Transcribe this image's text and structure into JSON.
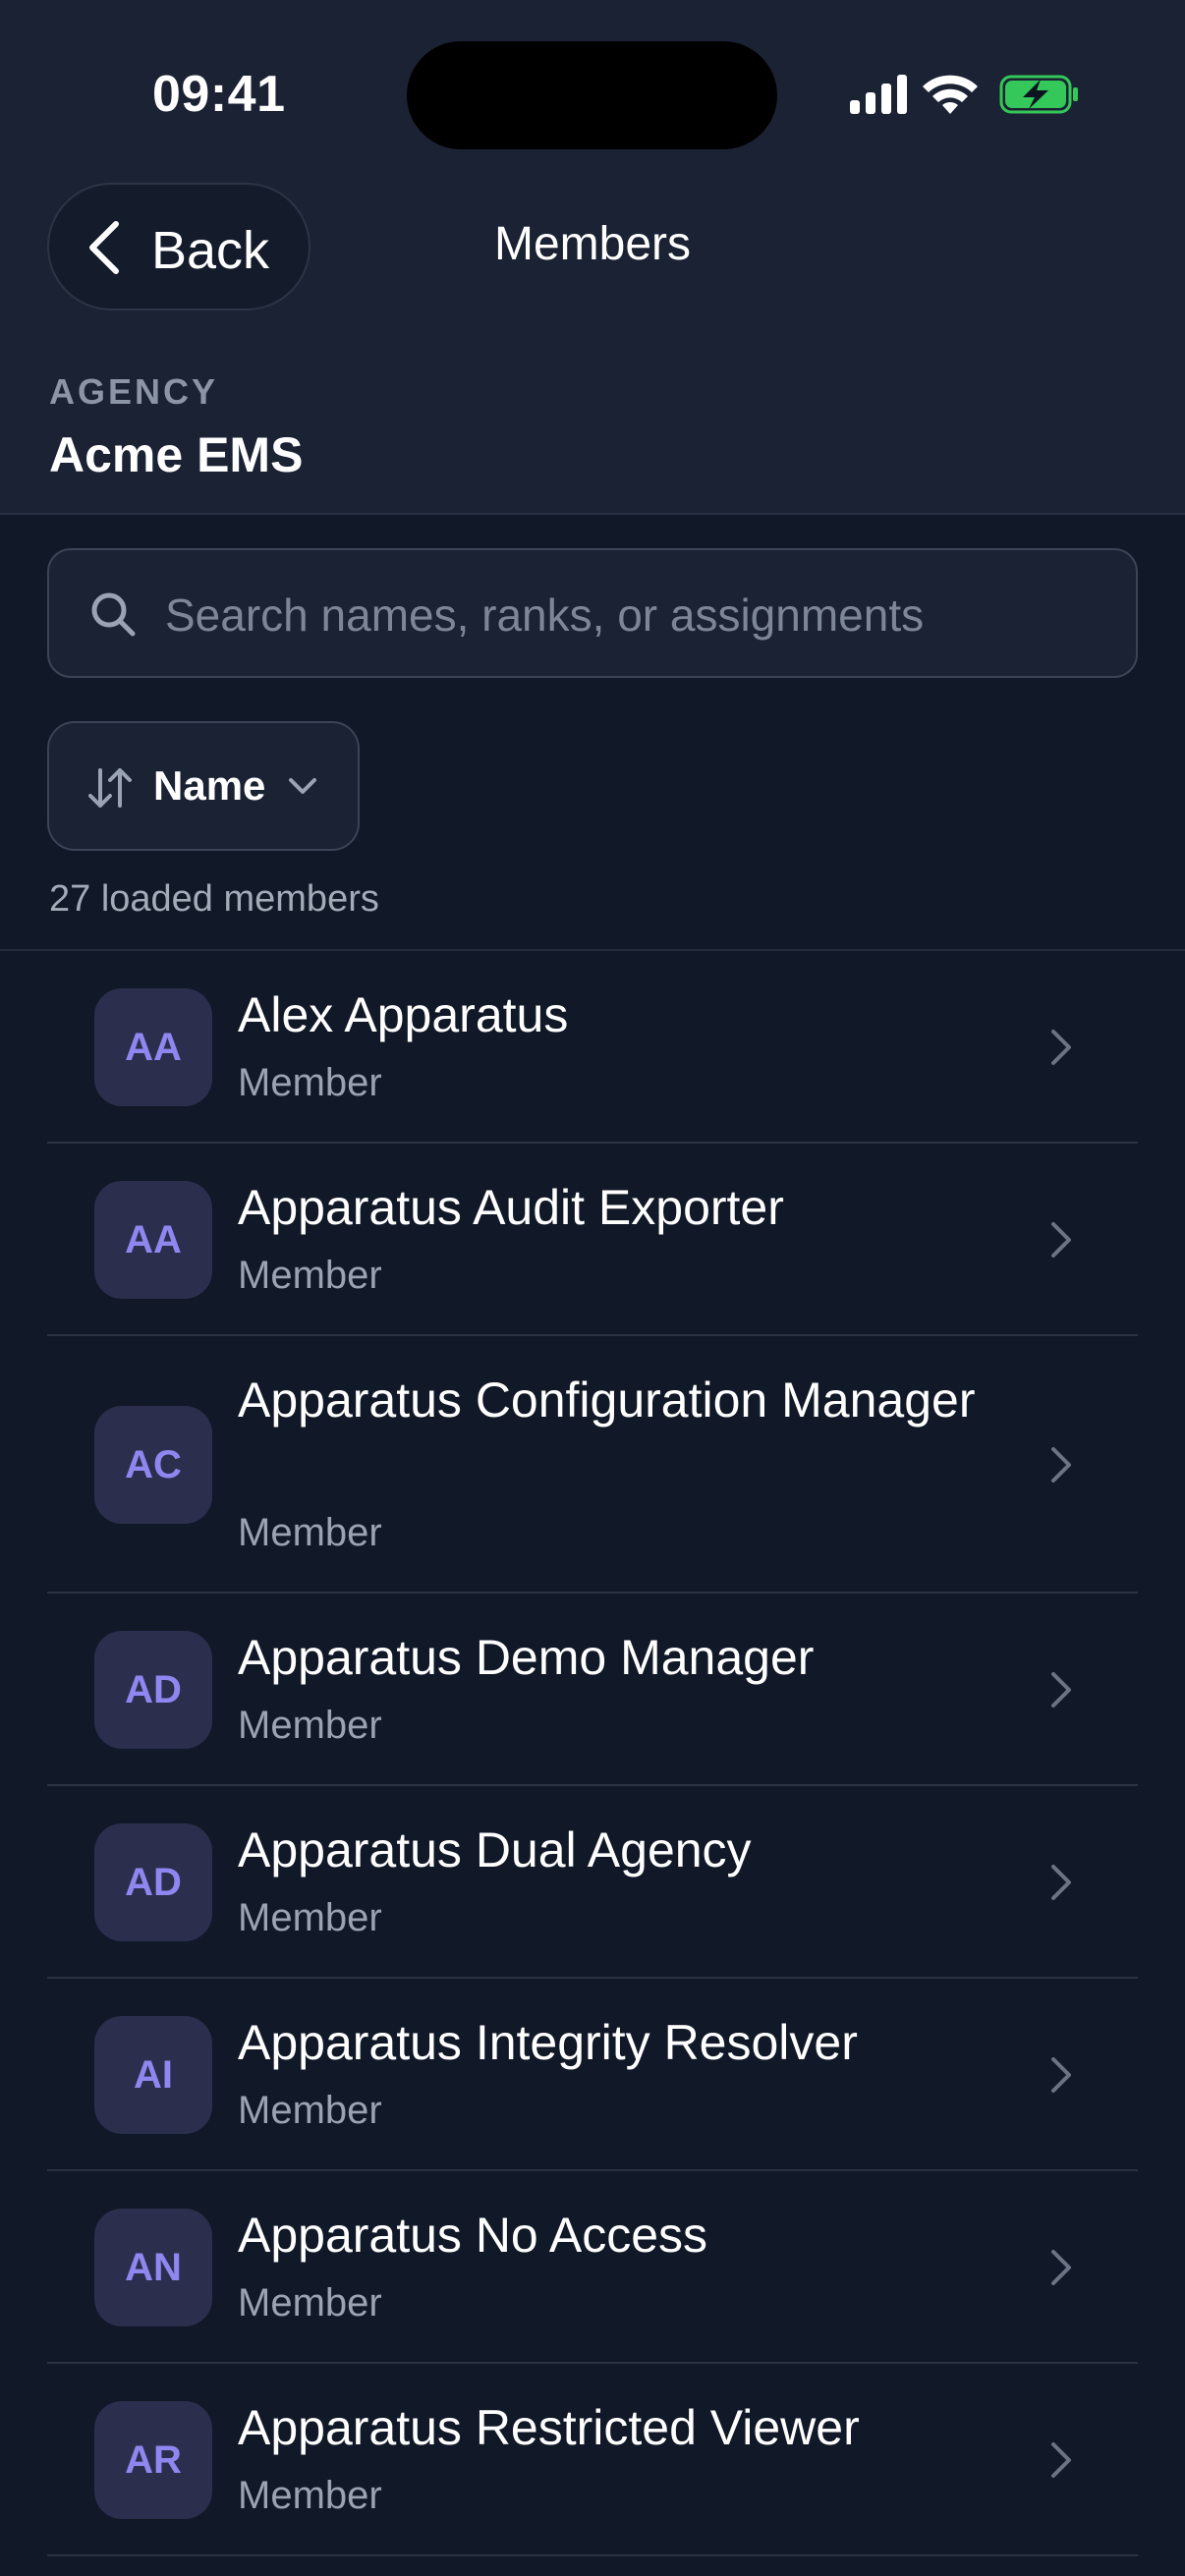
{
  "status_bar": {
    "time": "09:41"
  },
  "nav": {
    "back_label": "Back",
    "title": "Members"
  },
  "agency": {
    "label": "AGENCY",
    "name": "Acme EMS"
  },
  "search": {
    "placeholder": "Search names, ranks, or assignments",
    "value": ""
  },
  "sort": {
    "label": "Name"
  },
  "count_text": "27 loaded members",
  "members": [
    {
      "initials": "AA",
      "name": "Alex Apparatus",
      "role": "Member"
    },
    {
      "initials": "AA",
      "name": "Apparatus Audit Exporter",
      "role": "Member"
    },
    {
      "initials": "AC",
      "name": "Apparatus Configuration Manager",
      "role": "Member"
    },
    {
      "initials": "AD",
      "name": "Apparatus Demo Manager",
      "role": "Member"
    },
    {
      "initials": "AD",
      "name": "Apparatus Dual Agency",
      "role": "Member"
    },
    {
      "initials": "AI",
      "name": "Apparatus Integrity Resolver",
      "role": "Member"
    },
    {
      "initials": "AN",
      "name": "Apparatus No Access",
      "role": "Member"
    },
    {
      "initials": "AR",
      "name": "Apparatus Restricted Viewer",
      "role": "Member"
    }
  ],
  "colors": {
    "background": "#111827",
    "header_background": "#1a2233",
    "avatar_background": "#2b2f4d",
    "avatar_text": "#8f87f0",
    "battery_charging": "#34c759"
  }
}
